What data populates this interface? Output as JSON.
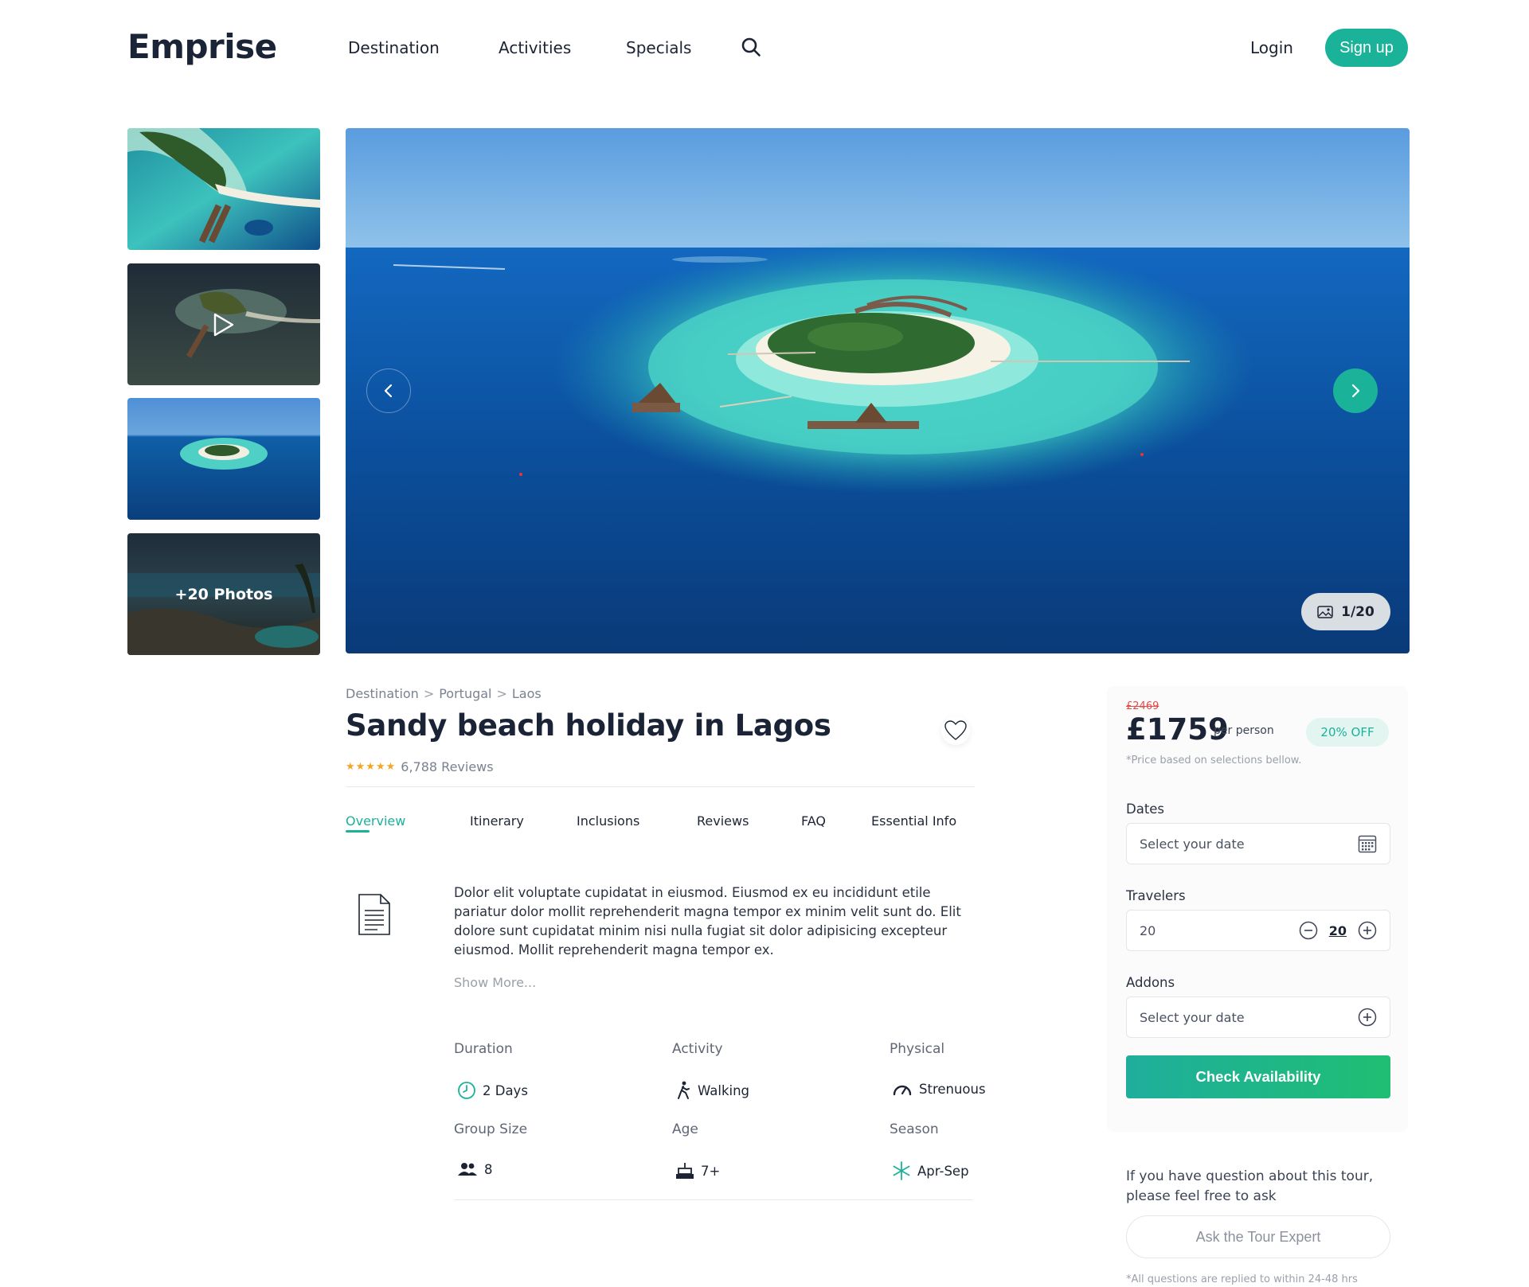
{
  "header": {
    "logo": "Emprise",
    "nav": [
      "Destination",
      "Activities",
      "Specials"
    ],
    "login": "Login",
    "signup": "Sign up"
  },
  "gallery": {
    "more_photos": "+20 Photos",
    "counter": "1/20"
  },
  "breadcrumb": [
    "Destination",
    "Portugal",
    "Laos"
  ],
  "breadcrumb_separator": ">",
  "tour": {
    "title": "Sandy beach holiday in Lagos",
    "stars": "★★★★★",
    "reviews": "6,788 Reviews"
  },
  "tabs": [
    "Overview",
    "Itinerary",
    "Inclusions",
    "Reviews",
    "FAQ",
    "Essential Info"
  ],
  "overview": {
    "description": "Dolor elit voluptate cupidatat in eiusmod. Eiusmod ex eu incididunt etile pariatur dolor mollit reprehenderit magna tempor ex minim velit sunt do. Elit dolore sunt cupidatat minim nisi nulla fugiat sit dolor adipisicing excepteur eiusmod. Mollit reprehenderit magna tempor ex.",
    "show_more": "Show More...",
    "facts": [
      {
        "label": "Duration",
        "value": "2 Days",
        "icon": "clock-icon"
      },
      {
        "label": "Activity",
        "value": "Walking",
        "icon": "walking-icon"
      },
      {
        "label": "Physical",
        "value": "Strenuous",
        "icon": "speedometer-icon"
      },
      {
        "label": "Group Size",
        "value": "8",
        "icon": "group-icon"
      },
      {
        "label": "Age",
        "value": "7+",
        "icon": "cake-icon"
      },
      {
        "label": "Season",
        "value": "Apr-Sep",
        "icon": "snowflake-icon"
      }
    ]
  },
  "booking": {
    "old_price": "£2469",
    "price": "£1759",
    "per_person": "per person",
    "discount": "20% OFF",
    "price_note": "*Price based on selections bellow.",
    "dates_label": "Dates",
    "dates_placeholder": "Select your date",
    "travelers_label": "Travelers",
    "travelers_value": "20",
    "travelers_count": "20",
    "addons_label": "Addons",
    "addons_placeholder": "Select your date",
    "check_button": "Check Availability",
    "question": "If you have  question about this tour, please feel free to ask",
    "ask_button": "Ask the Tour Expert",
    "reply_note": "*All questions are replied to within 24-48 hrs"
  },
  "colors": {
    "accent": "#1bb29a",
    "heading": "#1b2436",
    "star": "#f4a623",
    "old_price": "#e24b4b"
  }
}
